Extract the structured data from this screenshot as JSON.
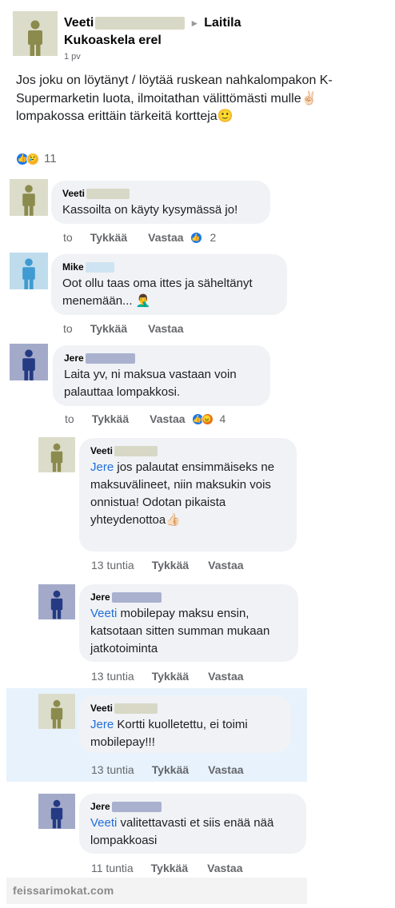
{
  "post": {
    "author": "Veeti",
    "group": "Laitila",
    "group_subtitle": "Kukoaskela erel",
    "time": "1 pv",
    "text": "Jos joku on löytänyt / löytää ruskean nahkalompakon K-Supermarketin luota, ilmoitathan välittömästi mulle✌🏻 lompakossa erittäin tärkeitä kortteja🙂",
    "reaction_count": "11",
    "reactions": [
      "like",
      "sad"
    ]
  },
  "comments": [
    {
      "author": "Veeti",
      "avatar": "olive",
      "text": "Kassoilta on käyty kysymässä jo!",
      "time": "to",
      "like_label": "Tykkää",
      "reply_label": "Vastaa",
      "reaction_count": "2"
    },
    {
      "author": "Mike",
      "avatar": "blue",
      "text": "Oot ollu taas oma ittes ja säheltänyt menemään... 🤦‍♂️",
      "time": "to",
      "like_label": "Tykkää",
      "reply_label": "Vastaa"
    },
    {
      "author": "Jere",
      "avatar": "navy",
      "text": "Laita yv, ni maksua vastaan voin palauttaa lompakkosi.",
      "time": "to",
      "like_label": "Tykkää",
      "reply_label": "Vastaa",
      "reaction_count": "4"
    }
  ],
  "replies": [
    {
      "author": "Veeti",
      "avatar": "olive",
      "mention": "Jere",
      "text": " jos palautat ensimmäiseks ne maksuvälineet, niin maksukin vois onnistua! Odotan pikaista yhteydenottoa👍🏻",
      "time": "13 tuntia",
      "like_label": "Tykkää",
      "reply_label": "Vastaa"
    },
    {
      "author": "Jere",
      "avatar": "navy",
      "mention": "Veeti",
      "text": " mobilepay maksu ensin, katsotaan sitten summan mukaan jatkotoiminta",
      "time": "13 tuntia",
      "like_label": "Tykkää",
      "reply_label": "Vastaa"
    },
    {
      "author": "Veeti",
      "avatar": "olive",
      "mention": "Jere",
      "text": " Kortti kuolletettu, ei toimi mobilepay!!!",
      "time": "13 tuntia",
      "like_label": "Tykkää",
      "reply_label": "Vastaa"
    },
    {
      "author": "Jere",
      "avatar": "navy",
      "mention": "Veeti",
      "text": " valitettavasti et siis enää nää lompakkoasi",
      "time": "11 tuntia",
      "like_label": "Tykkää",
      "reply_label": "Vastaa"
    }
  ],
  "footer": {
    "watermark": "feissarimokat.com"
  },
  "colors": {
    "mention": "#216fdb",
    "bubble": "#f0f2f5",
    "highlight": "#e7f2fc",
    "like": "#1877f2"
  }
}
